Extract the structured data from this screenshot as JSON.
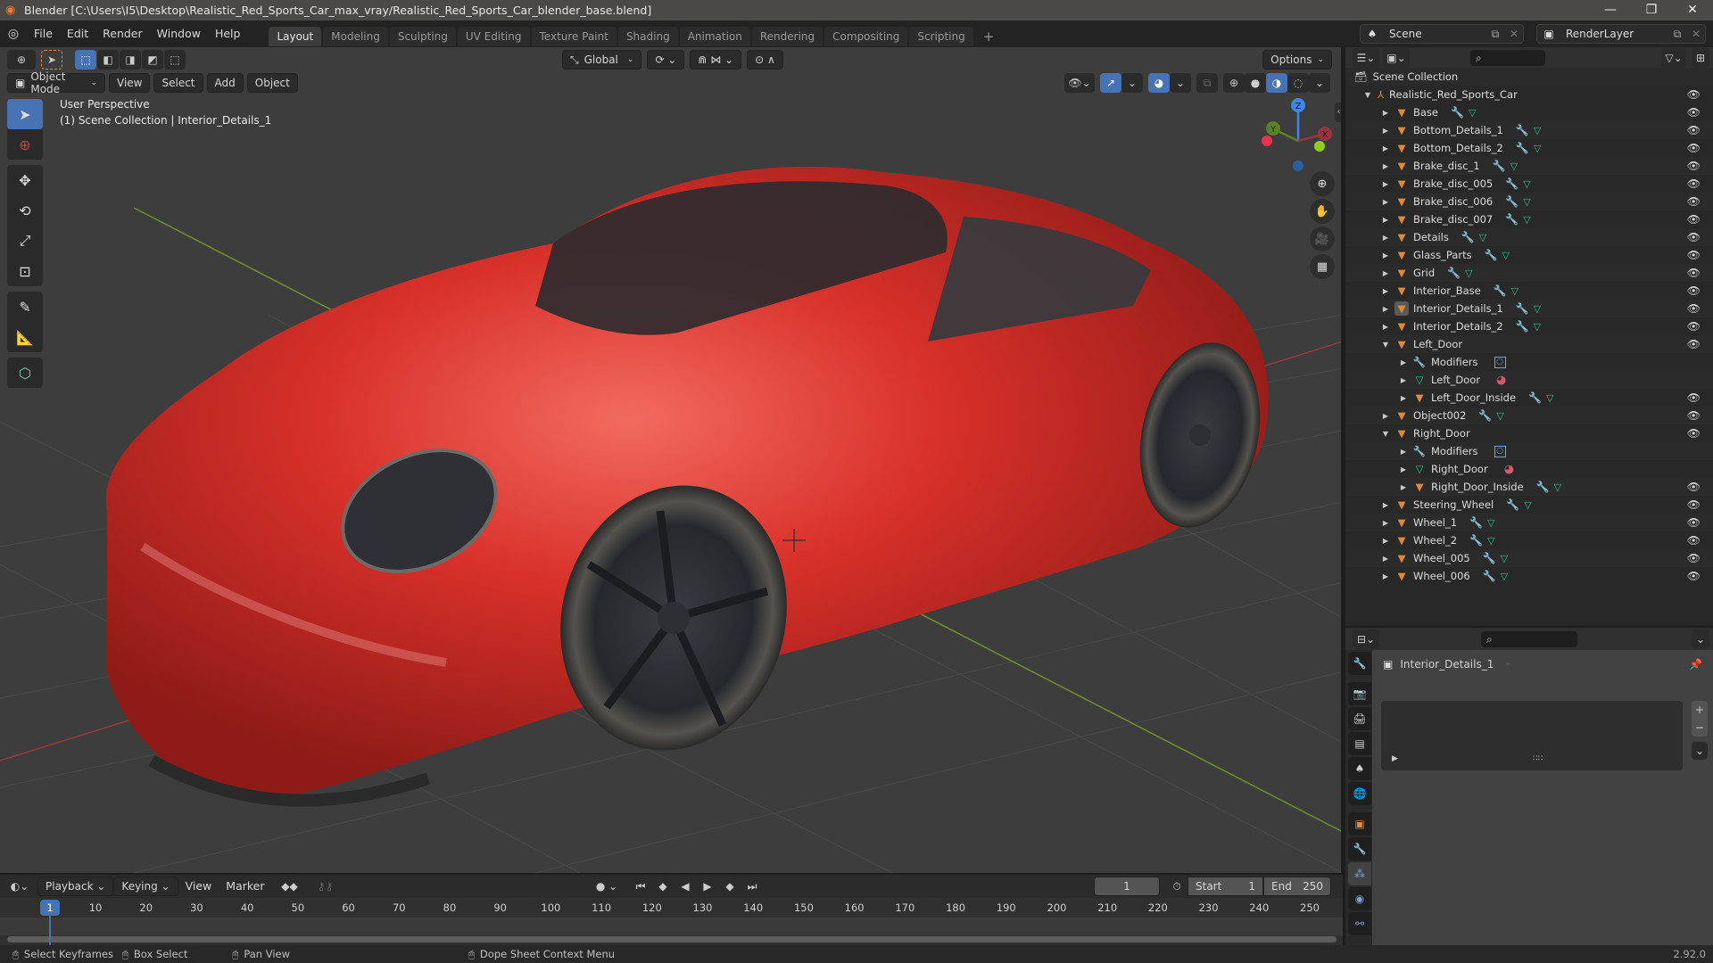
{
  "window": {
    "title": "Blender [C:\\Users\\I5\\Desktop\\Realistic_Red_Sports_Car_max_vray/Realistic_Red_Sports_Car_blender_base.blend]",
    "controls": [
      "—",
      "❐",
      "✕"
    ]
  },
  "menu": [
    "File",
    "Edit",
    "Render",
    "Window",
    "Help"
  ],
  "workspaces": [
    "Layout",
    "Modeling",
    "Sculpting",
    "UV Editing",
    "Texture Paint",
    "Shading",
    "Animation",
    "Rendering",
    "Compositing",
    "Scripting"
  ],
  "active_workspace": "Layout",
  "add_workspace": "+",
  "scene": {
    "name": "Scene",
    "render_layer": "RenderLayer"
  },
  "viewport": {
    "mode": "Object Mode",
    "header_menus": [
      "View",
      "Select",
      "Add",
      "Object"
    ],
    "transform_orientation": "Global",
    "options_label": "Options",
    "overlay_line1": "User Perspective",
    "overlay_line2": "(1) Scene Collection | Interior_Details_1",
    "gizmo": {
      "x": "X",
      "y": "Y",
      "z": "Z"
    },
    "tools": [
      "select-box",
      "cursor",
      "move",
      "rotate",
      "scale",
      "transform",
      "annotate",
      "measure",
      "add-cube"
    ],
    "nav": [
      "zoom",
      "pan",
      "camera",
      "ortho-grid"
    ]
  },
  "outliner": {
    "root": "Scene Collection",
    "collection": "Realistic_Red_Sports_Car",
    "items": [
      {
        "name": "Base",
        "level": 1,
        "expanded": false,
        "type": "object",
        "eye": true
      },
      {
        "name": "Bottom_Details_1",
        "level": 1,
        "expanded": false,
        "type": "object",
        "eye": true
      },
      {
        "name": "Bottom_Details_2",
        "level": 1,
        "expanded": false,
        "type": "object",
        "eye": true
      },
      {
        "name": "Brake_disc_1",
        "level": 1,
        "expanded": false,
        "type": "object",
        "eye": true
      },
      {
        "name": "Brake_disc_005",
        "level": 1,
        "expanded": false,
        "type": "object",
        "eye": true
      },
      {
        "name": "Brake_disc_006",
        "level": 1,
        "expanded": false,
        "type": "object",
        "eye": true
      },
      {
        "name": "Brake_disc_007",
        "level": 1,
        "expanded": false,
        "type": "object",
        "eye": true
      },
      {
        "name": "Details",
        "level": 1,
        "expanded": false,
        "type": "object",
        "eye": true
      },
      {
        "name": "Glass_Parts",
        "level": 1,
        "expanded": false,
        "type": "object",
        "eye": true
      },
      {
        "name": "Grid",
        "level": 1,
        "expanded": false,
        "type": "object",
        "eye": true
      },
      {
        "name": "Interior_Base",
        "level": 1,
        "expanded": false,
        "type": "object",
        "eye": true
      },
      {
        "name": "Interior_Details_1",
        "level": 1,
        "expanded": false,
        "type": "object",
        "eye": true,
        "selected": true
      },
      {
        "name": "Interior_Details_2",
        "level": 1,
        "expanded": false,
        "type": "object",
        "eye": true
      },
      {
        "name": "Left_Door",
        "level": 1,
        "expanded": true,
        "type": "object-noicons",
        "eye": true
      },
      {
        "name": "Modifiers",
        "level": 2,
        "expanded": false,
        "type": "modifiers",
        "eye": false
      },
      {
        "name": "Left_Door",
        "level": 2,
        "expanded": false,
        "type": "meshdata",
        "eye": false
      },
      {
        "name": "Left_Door_Inside",
        "level": 2,
        "expanded": false,
        "type": "object",
        "eye": true
      },
      {
        "name": "Object002",
        "level": 1,
        "expanded": false,
        "type": "object",
        "eye": true
      },
      {
        "name": "Right_Door",
        "level": 1,
        "expanded": true,
        "type": "object-noicons",
        "eye": true
      },
      {
        "name": "Modifiers",
        "level": 2,
        "expanded": false,
        "type": "modifiers",
        "eye": false
      },
      {
        "name": "Right_Door",
        "level": 2,
        "expanded": false,
        "type": "meshdata",
        "eye": false
      },
      {
        "name": "Right_Door_Inside",
        "level": 2,
        "expanded": false,
        "type": "object",
        "eye": true
      },
      {
        "name": "Steering_Wheel",
        "level": 1,
        "expanded": false,
        "type": "object",
        "eye": true
      },
      {
        "name": "Wheel_1",
        "level": 1,
        "expanded": false,
        "type": "object",
        "eye": true
      },
      {
        "name": "Wheel_2",
        "level": 1,
        "expanded": false,
        "type": "object",
        "eye": true
      },
      {
        "name": "Wheel_005",
        "level": 1,
        "expanded": false,
        "type": "object",
        "eye": true
      },
      {
        "name": "Wheel_006",
        "level": 1,
        "expanded": false,
        "type": "object",
        "eye": true
      }
    ]
  },
  "properties": {
    "object_name": "Interior_Details_1",
    "tabs": [
      "tool",
      "render",
      "output",
      "view-layer",
      "scene",
      "world",
      "object",
      "modifiers",
      "particles",
      "physics",
      "constraints"
    ],
    "active_tab": "particles",
    "list_add": "+",
    "list_remove": "−",
    "list_more": "⌄"
  },
  "timeline": {
    "menus": [
      "Playback",
      "Keying",
      "View",
      "Marker"
    ],
    "current_frame": "1",
    "start_label": "Start",
    "start": "1",
    "end_label": "End",
    "end": "250",
    "ruler": [
      "10",
      "20",
      "30",
      "40",
      "50",
      "60",
      "70",
      "80",
      "90",
      "100",
      "110",
      "120",
      "130",
      "140",
      "150",
      "160",
      "170",
      "180",
      "190",
      "200",
      "210",
      "220",
      "230",
      "240",
      "250"
    ]
  },
  "status": {
    "items": [
      "Select Keyframes",
      "Box Select",
      "Pan View",
      "Dope Sheet Context Menu"
    ],
    "version": "2.92.0"
  },
  "colors": {
    "accent": "#4772b3",
    "object_orange": "#e08a3c",
    "mesh_green": "#2fbf8c",
    "wrench_blue": "#7f9fd9",
    "car_red": "#d8302a"
  }
}
